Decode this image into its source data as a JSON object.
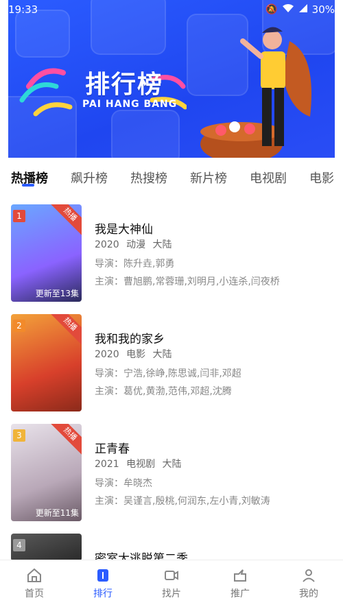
{
  "status": {
    "time": "19:33",
    "battery": "30%"
  },
  "banner": {
    "title": "排行榜",
    "subtitle": "PAI HANG BANG"
  },
  "tabs": [
    "热播榜",
    "飙升榜",
    "热搜榜",
    "新片榜",
    "电视剧",
    "电影"
  ],
  "active_tab": "热播榜",
  "list": [
    {
      "rank": "1",
      "hot_badge": "热播",
      "poster_update": "更新至13集",
      "title": "我是大神仙",
      "year": "2020",
      "genre": "动漫",
      "region": "大陆",
      "director": "导演：陈升垚,郭勇",
      "cast": "主演：曹旭鹏,常蓉珊,刘明月,小连杀,闫夜桥"
    },
    {
      "rank": "2",
      "hot_badge": "热播",
      "poster_update": "",
      "title": "我和我的家乡",
      "year": "2020",
      "genre": "电影",
      "region": "大陆",
      "director": "导演：宁浩,徐峥,陈思诚,闫非,邓超",
      "cast": "主演：葛优,黄渤,范伟,邓超,沈腾"
    },
    {
      "rank": "3",
      "hot_badge": "热播",
      "poster_update": "更新至11集",
      "title": "正青春",
      "year": "2021",
      "genre": "电视剧",
      "region": "大陆",
      "director": "导演：牟晓杰",
      "cast": "主演：吴谨言,殷桃,何润东,左小青,刘敏涛"
    },
    {
      "rank": "4",
      "hot_badge": "",
      "poster_update": "",
      "title": "密室大逃脱第二季",
      "year": "",
      "genre": "",
      "region": "",
      "director": "",
      "cast": ""
    }
  ],
  "bottom_nav": [
    {
      "label": "首页",
      "icon": "home-icon"
    },
    {
      "label": "排行",
      "icon": "ranking-icon"
    },
    {
      "label": "找片",
      "icon": "video-icon"
    },
    {
      "label": "推广",
      "icon": "share-icon"
    },
    {
      "label": "我的",
      "icon": "user-icon"
    }
  ],
  "colors": {
    "accent": "#2b5cff",
    "hot_badge": "#e24a3b"
  }
}
